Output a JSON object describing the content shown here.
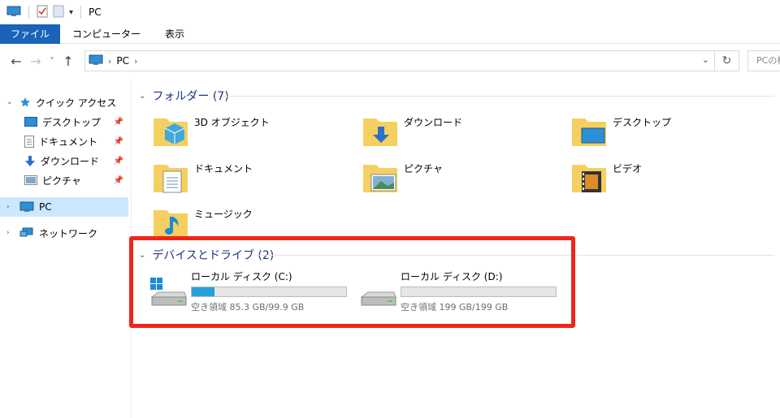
{
  "window": {
    "title": "PC"
  },
  "ribbon": {
    "tabs": [
      "ファイル",
      "コンピューター",
      "表示"
    ]
  },
  "address": {
    "crumb": "PC",
    "search_placeholder": "PCの検索"
  },
  "nav": {
    "quick_access": "クイック アクセス",
    "items": [
      "デスクトップ",
      "ドキュメント",
      "ダウンロード",
      "ピクチャ"
    ],
    "pc": "PC",
    "network": "ネットワーク"
  },
  "folders": {
    "header": "フォルダー (7)",
    "items": [
      "3D オブジェクト",
      "ダウンロード",
      "デスクトップ",
      "ドキュメント",
      "ピクチャ",
      "ビデオ",
      "ミュージック"
    ]
  },
  "devices": {
    "header": "デバイスとドライブ (2)",
    "drives": [
      {
        "name": "ローカル ディスク (C:)",
        "free": "空き領域 85.3 GB/99.9 GB",
        "used_fraction": 0.146
      },
      {
        "name": "ローカル ディスク (D:)",
        "free": "空き領域 199 GB/199 GB",
        "used_fraction": 0.0
      }
    ]
  },
  "colors": {
    "accent": "#1a63b8",
    "selection": "#cce8ff",
    "bar_fill": "#26a0da",
    "highlight": "#f0251a",
    "group_header": "#1e3287"
  }
}
